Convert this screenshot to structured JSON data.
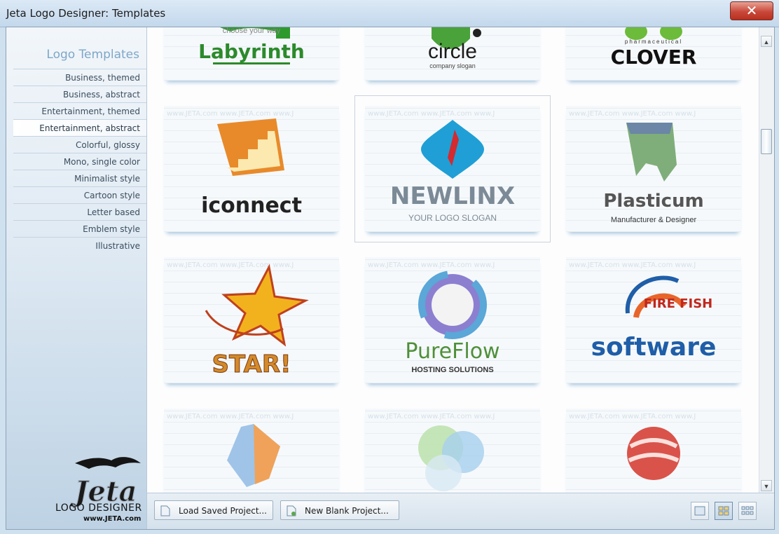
{
  "window": {
    "title": "Jeta Logo Designer: Templates",
    "close_glyph": "✕"
  },
  "sidebar": {
    "title": "Logo Templates",
    "items": [
      {
        "label": "Business, themed",
        "selected": false
      },
      {
        "label": "Business, abstract",
        "selected": false
      },
      {
        "label": "Entertainment, themed",
        "selected": false
      },
      {
        "label": "Entertainment, abstract",
        "selected": true
      },
      {
        "label": "Colorful, glossy",
        "selected": false
      },
      {
        "label": "Mono, single color",
        "selected": false
      },
      {
        "label": "Minimalist style",
        "selected": false
      },
      {
        "label": "Cartoon style",
        "selected": false
      },
      {
        "label": "Letter based",
        "selected": false
      },
      {
        "label": "Emblem style",
        "selected": false
      },
      {
        "label": "Illustrative",
        "selected": false
      }
    ],
    "brand": {
      "name": "Jeta",
      "subtitle": "LOGO DESIGNER",
      "url": "www.JETA.com"
    }
  },
  "watermark": "www.JETA.com  www.JETA.com  www.J",
  "templates": [
    {
      "name": "Labyrinth",
      "slogan": "choose your way"
    },
    {
      "name": "circle",
      "slogan": "company slogan"
    },
    {
      "name": "CLOVER",
      "slogan": "pharmaceutical"
    },
    {
      "name": "iconnect",
      "slogan": ""
    },
    {
      "name": "NEWLINX",
      "slogan": "YOUR LOGO SLOGAN"
    },
    {
      "name": "Plasticum",
      "slogan": "Manufacturer & Designer"
    },
    {
      "name": "STAR!",
      "slogan": ""
    },
    {
      "name": "PureFlow",
      "slogan": "HOSTING SOLUTIONS"
    },
    {
      "name": "software",
      "slogan": "FIRE FISH"
    },
    {
      "name": "",
      "slogan": ""
    },
    {
      "name": "",
      "slogan": ""
    },
    {
      "name": "",
      "slogan": ""
    }
  ],
  "buttons": {
    "load": "Load Saved Project...",
    "new": "New Blank Project..."
  },
  "colors": {
    "accent": "#7ea7c8",
    "close": "#c9483a"
  }
}
